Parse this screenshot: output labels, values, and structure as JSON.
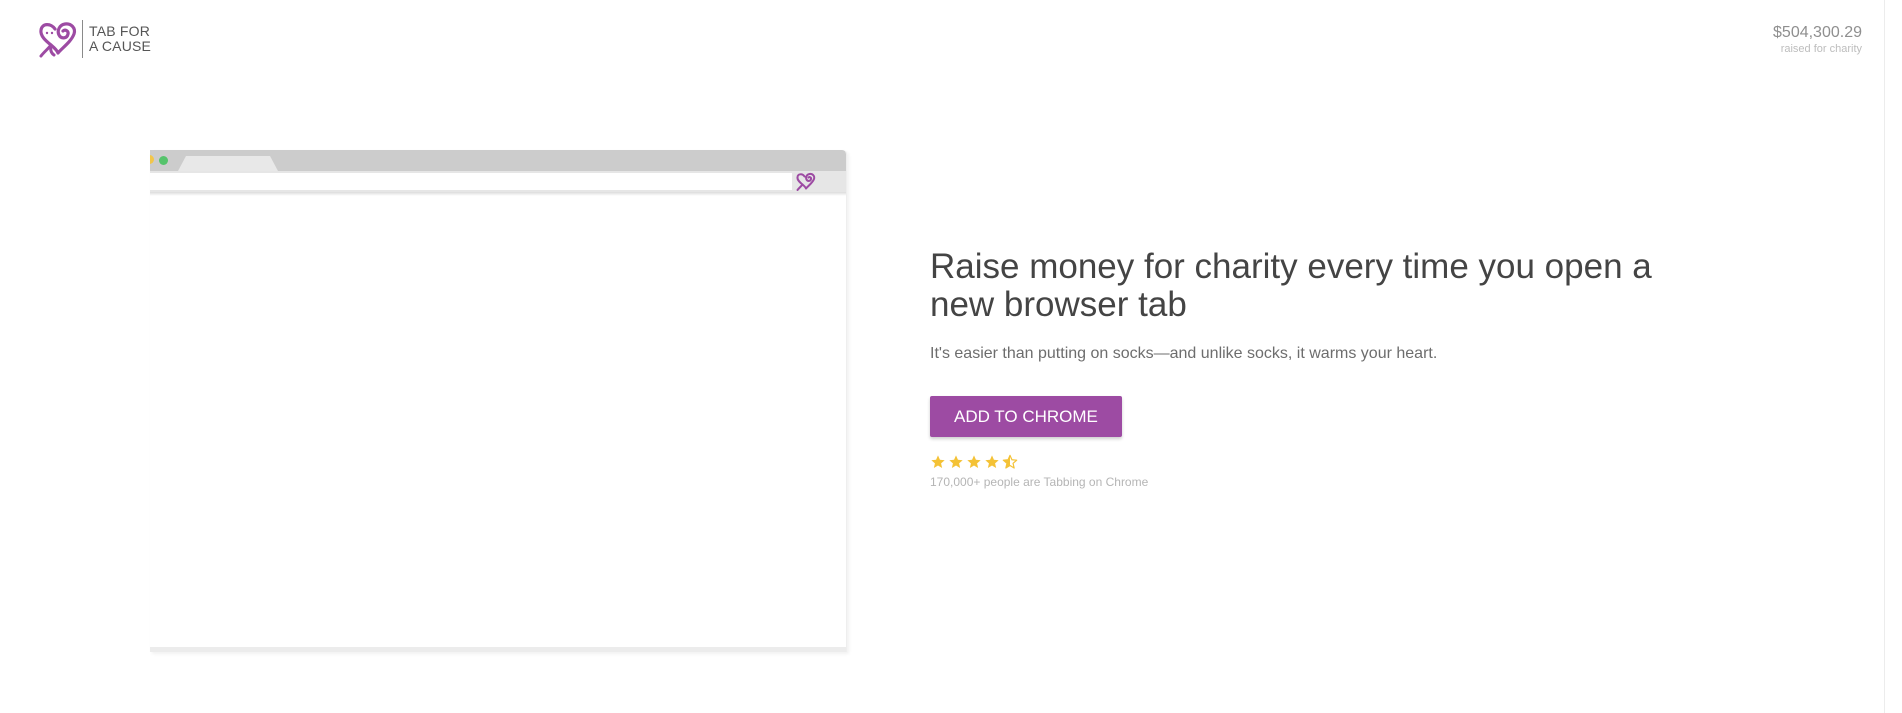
{
  "header": {
    "logo_line1": "TAB FOR",
    "logo_line2": "A CAUSE",
    "raised_amount": "$504,300.29",
    "raised_label": "raised for charity"
  },
  "hero": {
    "title": "Raise money for charity every time you open a new browser tab",
    "subtitle": "It's easier than putting on socks—and unlike socks, it warms your heart.",
    "cta_label": "ADD TO CHROME",
    "rating": 4.5,
    "rating_max": 5,
    "users_text": "170,000+ people are Tabbing on Chrome"
  },
  "icons": {
    "logo": "heart-loop-icon",
    "extension": "heart-loop-icon",
    "rating": "star-icon"
  },
  "colors": {
    "brand": "#9d4ba3",
    "star": "#f4c236",
    "dot_green": "#55c36b",
    "dot_yellow": "#f2c64a"
  }
}
